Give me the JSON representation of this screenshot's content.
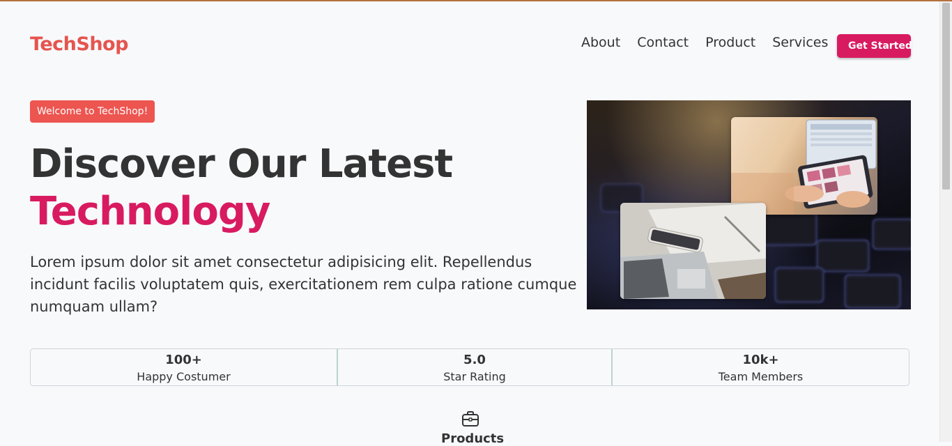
{
  "brand": {
    "logo": "TechShop"
  },
  "nav": {
    "items": [
      "About",
      "Contact",
      "Product",
      "Services"
    ],
    "cta": "Get Started"
  },
  "hero": {
    "badge": "Welcome to TechShop!",
    "title_line1": "Discover Our Latest",
    "title_line2": "Technology",
    "description": "Lorem ipsum dolor sit amet consectetur adipisicing elit. Repellendus incidunt facilis voluptatem quis, exercitationem rem culpa ratione cumque numquam ullam?"
  },
  "stats": [
    {
      "value": "100+",
      "label": "Happy Costumer"
    },
    {
      "value": "5.0",
      "label": "Star Rating"
    },
    {
      "value": "10k+",
      "label": "Team Members"
    }
  ],
  "section": {
    "icon": "briefcase-icon",
    "title": "Products"
  },
  "colors": {
    "brand": "#e5554f",
    "accent": "#d81b60",
    "badge": "#ed5550",
    "text": "#333333"
  }
}
